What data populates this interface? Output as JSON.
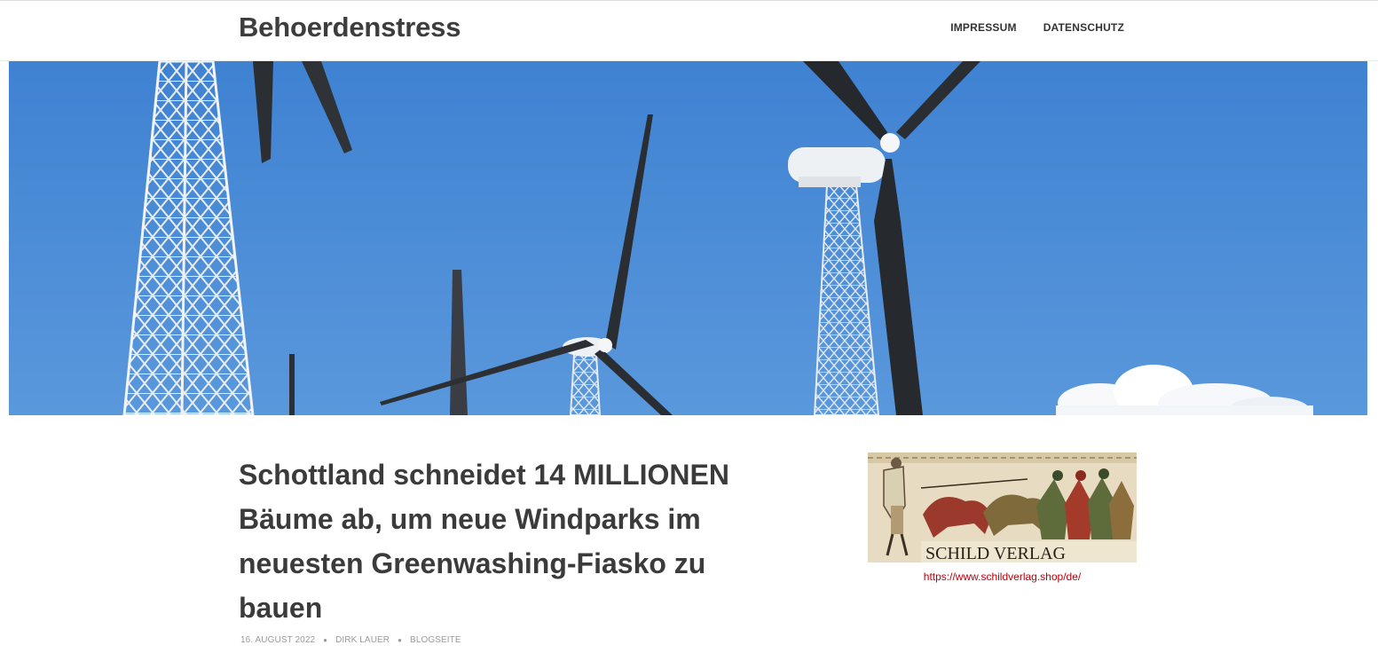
{
  "site": {
    "title": "Behoerdenstress"
  },
  "nav": {
    "items": [
      {
        "label": "IMPRESSUM"
      },
      {
        "label": "DATENSCHUTZ"
      }
    ]
  },
  "hero": {
    "sky_color": "#4a8ad4"
  },
  "post": {
    "title": "Schottland schneidet 14 MILLIONEN Bäume ab, um neue Windparks im neuesten Greenwashing-Fiasko zu bauen",
    "date": "16. AUGUST 2022",
    "author": "DIRK LAUER",
    "category": "BLOGSEITE"
  },
  "sidebar": {
    "ad_text": "SCHILD VERLAG",
    "ad_url": "https://www.schildverlag.shop/de/",
    "link_color": "#b8000a"
  }
}
